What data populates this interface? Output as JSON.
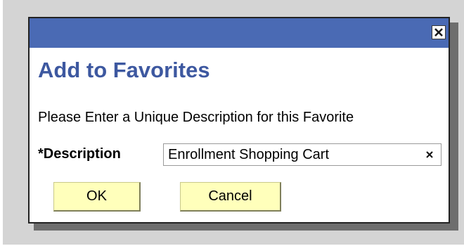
{
  "dialog": {
    "title": "Add to Favorites",
    "instructions": "Please Enter a Unique Description for this Favorite",
    "description_label": "*Description",
    "description_value": "Enrollment Shopping Cart",
    "ok_label": "OK",
    "cancel_label": "Cancel",
    "close_icon": "close-x-icon",
    "clear_icon": "clear-x-icon"
  },
  "colors": {
    "titlebar": "#4a6ab4",
    "title_text": "#3d58a0",
    "button_bg": "#ffffbb"
  }
}
